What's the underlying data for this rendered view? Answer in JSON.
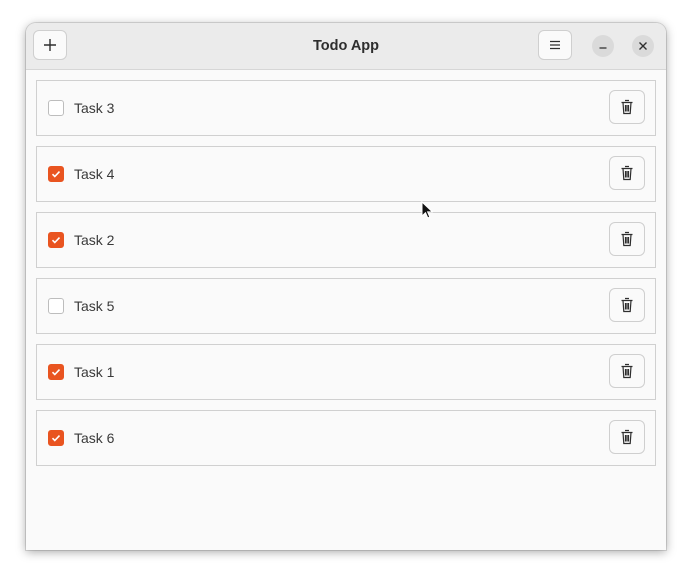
{
  "window": {
    "title": "Todo App"
  },
  "header": {
    "add_icon": "plus-icon",
    "menu_icon": "hamburger-menu-icon",
    "minimize_icon": "minimize-icon",
    "close_icon": "close-icon"
  },
  "colors": {
    "accent": "#e95420",
    "row_border": "#d0d0d0",
    "text": "#3a3a3a"
  },
  "tasks": [
    {
      "label": "Task 3",
      "checked": false
    },
    {
      "label": "Task 4",
      "checked": true
    },
    {
      "label": "Task 2",
      "checked": true
    },
    {
      "label": "Task 5",
      "checked": false
    },
    {
      "label": "Task 1",
      "checked": true
    },
    {
      "label": "Task 6",
      "checked": true
    }
  ],
  "delete_icon": "trash-icon"
}
